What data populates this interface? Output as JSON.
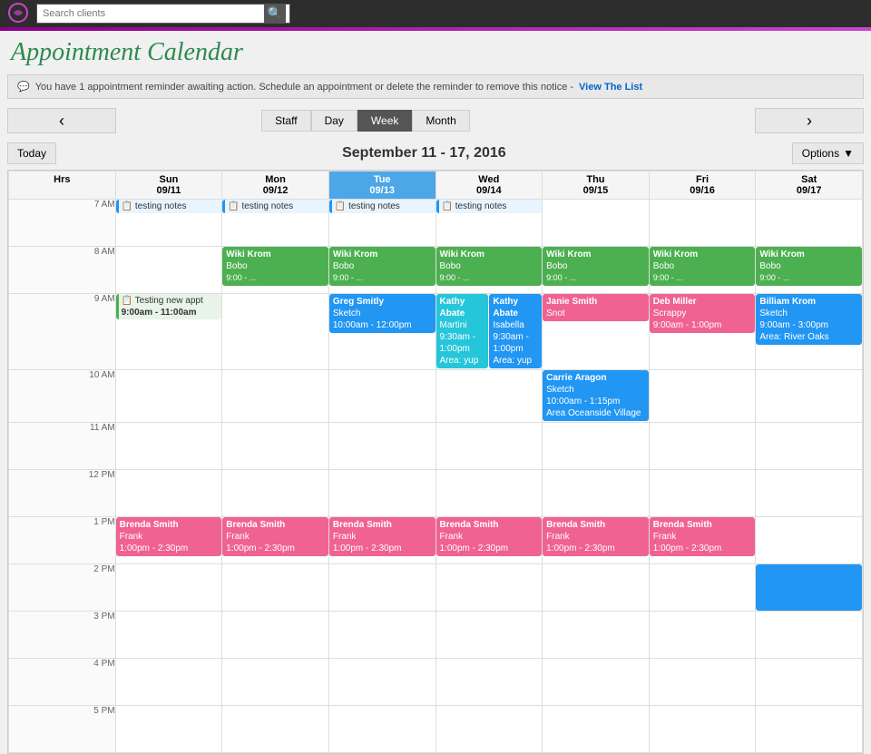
{
  "topbar": {
    "search_placeholder": "Search clients",
    "search_icon": "🔍"
  },
  "page": {
    "title": "Appointment Calendar"
  },
  "notice": {
    "text": "You have 1 appointment reminder awaiting action. Schedule an appointment or delete the reminder to remove this notice -",
    "link_text": "View The List"
  },
  "nav": {
    "prev_label": "‹",
    "next_label": "›",
    "tabs": [
      "Staff",
      "Day",
      "Week",
      "Month"
    ],
    "active_tab": "Week"
  },
  "date_range": "September 11 - 17, 2016",
  "today_label": "Today",
  "options_label": "Options",
  "calendar": {
    "headers": [
      {
        "label": "Hrs",
        "date": ""
      },
      {
        "label": "Sun",
        "date": "09/11"
      },
      {
        "label": "Mon",
        "date": "09/12"
      },
      {
        "label": "Tue",
        "date": "09/13",
        "today": true
      },
      {
        "label": "Wed",
        "date": "09/14"
      },
      {
        "label": "Thu",
        "date": "09/15"
      },
      {
        "label": "Fri",
        "date": "09/16"
      },
      {
        "label": "Sat",
        "date": "09/17"
      }
    ],
    "hours": [
      "7 AM",
      "8 AM",
      "9 AM",
      "10 AM",
      "11 AM",
      "12 PM",
      "1 PM",
      "2 PM",
      "3 PM",
      "4 PM",
      "5 PM"
    ]
  }
}
